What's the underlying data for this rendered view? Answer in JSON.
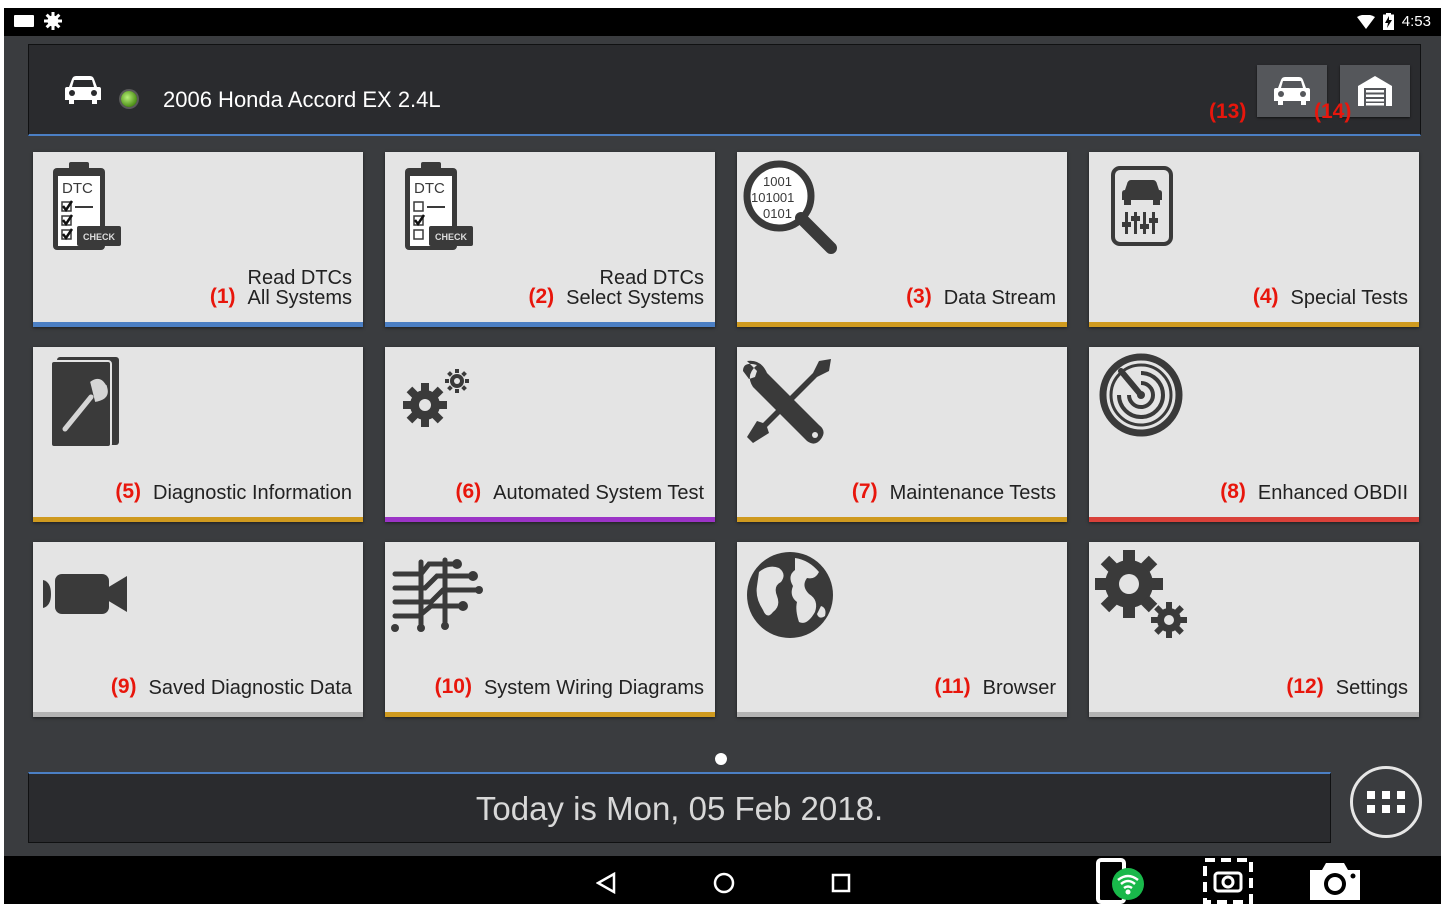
{
  "status_bar": {
    "time": "4:53"
  },
  "vehicle": {
    "name": "2006 Honda Accord EX 2.4L"
  },
  "vehicle_buttons": {
    "car_label": "(13)",
    "garage_label": "(14)"
  },
  "tiles": [
    {
      "num": "(1)",
      "line1": "Read DTCs",
      "line2": "All Systems",
      "icon": "dtc-clipboard-icon",
      "accent": "#4b7fc4"
    },
    {
      "num": "(2)",
      "line1": "Read DTCs",
      "line2": "Select Systems",
      "icon": "dtc-clipboard-icon",
      "accent": "#4b7fc4"
    },
    {
      "num": "(3)",
      "line1": "Data Stream",
      "icon": "binary-magnifier-icon",
      "accent": "#cf9a1f"
    },
    {
      "num": "(4)",
      "line1": "Special Tests",
      "icon": "car-sliders-icon",
      "accent": "#cf9a1f"
    },
    {
      "num": "(5)",
      "line1": "Diagnostic Information",
      "icon": "wrench-book-icon",
      "accent": "#cf9a1f"
    },
    {
      "num": "(6)",
      "line1": "Automated System Test",
      "icon": "gears-icon",
      "accent": "#9b34c6"
    },
    {
      "num": "(7)",
      "line1": "Maintenance Tests",
      "icon": "wrench-screwdriver-icon",
      "accent": "#cf9a1f"
    },
    {
      "num": "(8)",
      "line1": "Enhanced OBDII",
      "icon": "radar-icon",
      "accent": "#d9413a"
    },
    {
      "num": "(9)",
      "line1": "Saved Diagnostic Data",
      "icon": "video-camera-icon",
      "accent": "#b3b3b3"
    },
    {
      "num": "(10)",
      "line1": "System Wiring Diagrams",
      "icon": "wiring-icon",
      "accent": "#cf9a1f"
    },
    {
      "num": "(11)",
      "line1": "Browser",
      "icon": "globe-icon",
      "accent": "#b3b3b3"
    },
    {
      "num": "(12)",
      "line1": "Settings",
      "icon": "settings-gears-icon",
      "accent": "#b3b3b3"
    }
  ],
  "date_text": "Today is Mon, 05 Feb 2018.",
  "navigation": {
    "buttons": [
      "back-icon",
      "home-icon",
      "recents-icon",
      "vci-wifi-icon",
      "screen-capture-icon",
      "camera-icon"
    ]
  }
}
